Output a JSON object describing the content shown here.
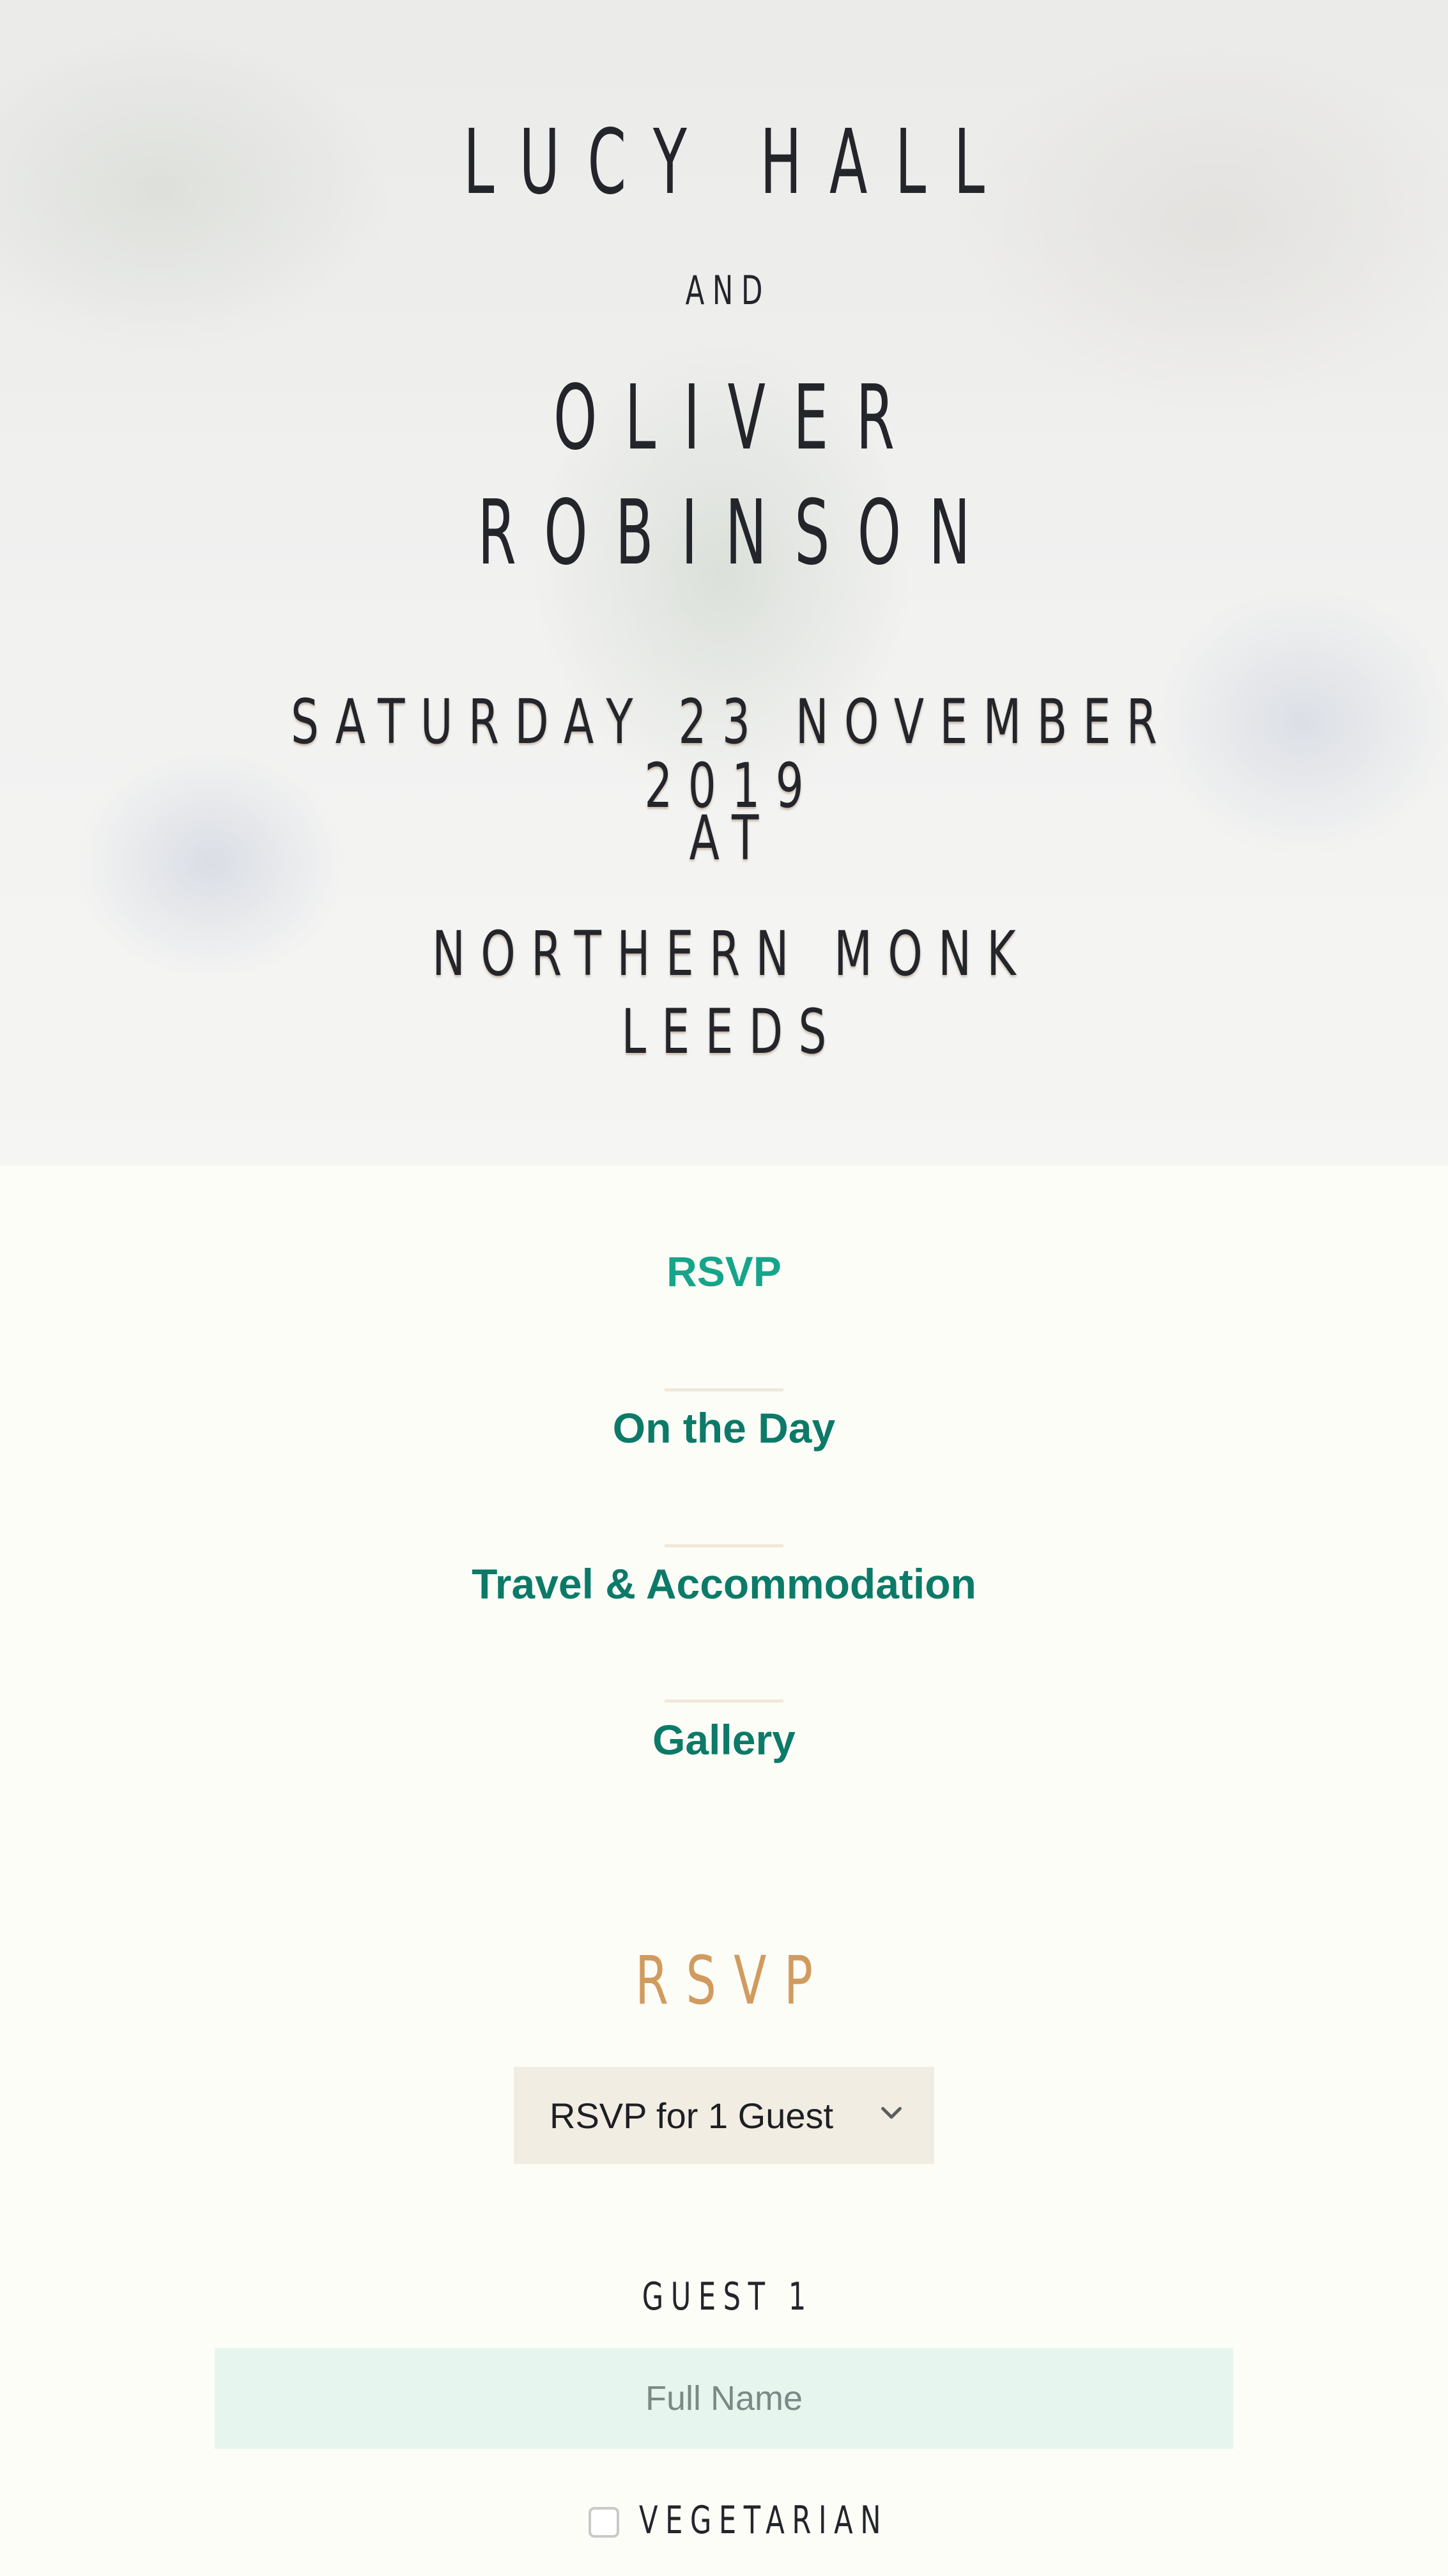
{
  "hero": {
    "name_one": "LUCY HALL",
    "and": "AND",
    "name_two": "OLIVER ROBINSON",
    "date": "SATURDAY 23 NOVEMBER 2019",
    "at": "AT",
    "venue": "NORTHERN MONK",
    "city": "LEEDS"
  },
  "nav": {
    "items": [
      {
        "label": "RSVP",
        "active": true
      },
      {
        "label": "On the Day",
        "active": false
      },
      {
        "label": "Travel & Accommodation",
        "active": false
      },
      {
        "label": "Gallery",
        "active": false
      }
    ]
  },
  "rsvp": {
    "heading": "RSVP",
    "guest_select": {
      "selected": "RSVP for 1 Guest",
      "icon": "chevron-down-icon"
    },
    "guest_label": "GUEST 1",
    "name_input": {
      "value": "",
      "placeholder": "Full Name"
    },
    "vegetarian": {
      "label": "VEGETARIAN",
      "checked": false
    }
  },
  "colors": {
    "page_background": "#fdfdf7",
    "heading_dark": "#23252b",
    "gold": "#d6a36a",
    "nav_green": "#0c7a68",
    "nav_active_green": "#16a58a",
    "select_background": "#f1ede3",
    "input_background": "#e7f5ef"
  }
}
